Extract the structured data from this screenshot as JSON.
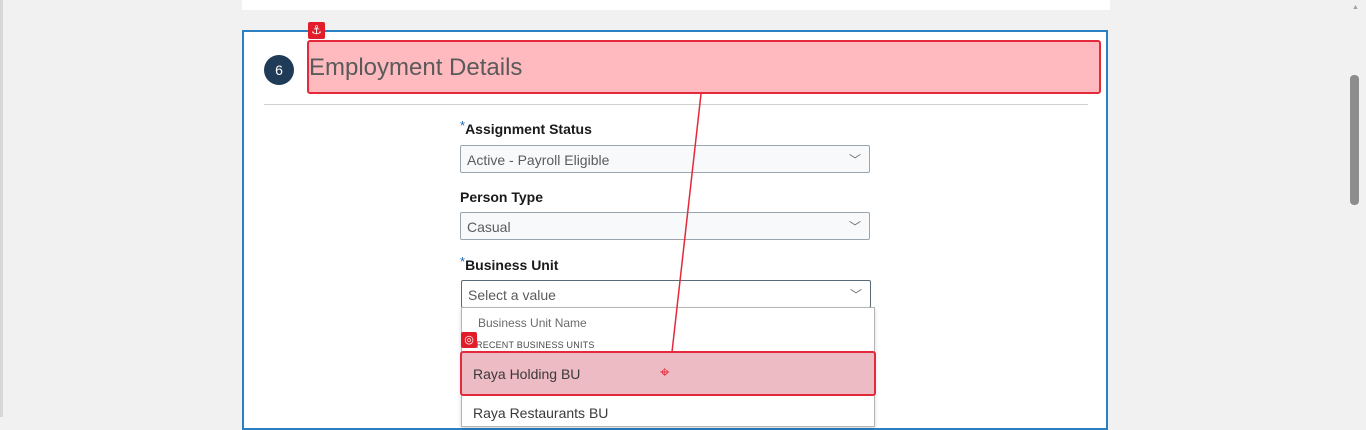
{
  "form": {
    "step_number": "6",
    "section_title": "Employment Details",
    "required_marker": "*",
    "assignment_status": {
      "label": "Assignment Status",
      "value": "Active - Payroll Eligible"
    },
    "person_type": {
      "label": "Person Type",
      "value": "Casual"
    },
    "business_unit": {
      "label": "Business Unit",
      "placeholder": "Select a value"
    }
  },
  "dropdown": {
    "header": "Business Unit Name",
    "section_label": "RECENT BUSINESS UNITS",
    "options": [
      "Raya Holding BU",
      "Raya Restaurants BU"
    ]
  },
  "annotations": {
    "anchor_icon": "anchor-icon",
    "target_icon": "target-icon",
    "crosshair_icon": "crosshair-icon",
    "highlight_color": "#e3293a"
  },
  "icons": {
    "chevron": "chevron-down-icon"
  }
}
